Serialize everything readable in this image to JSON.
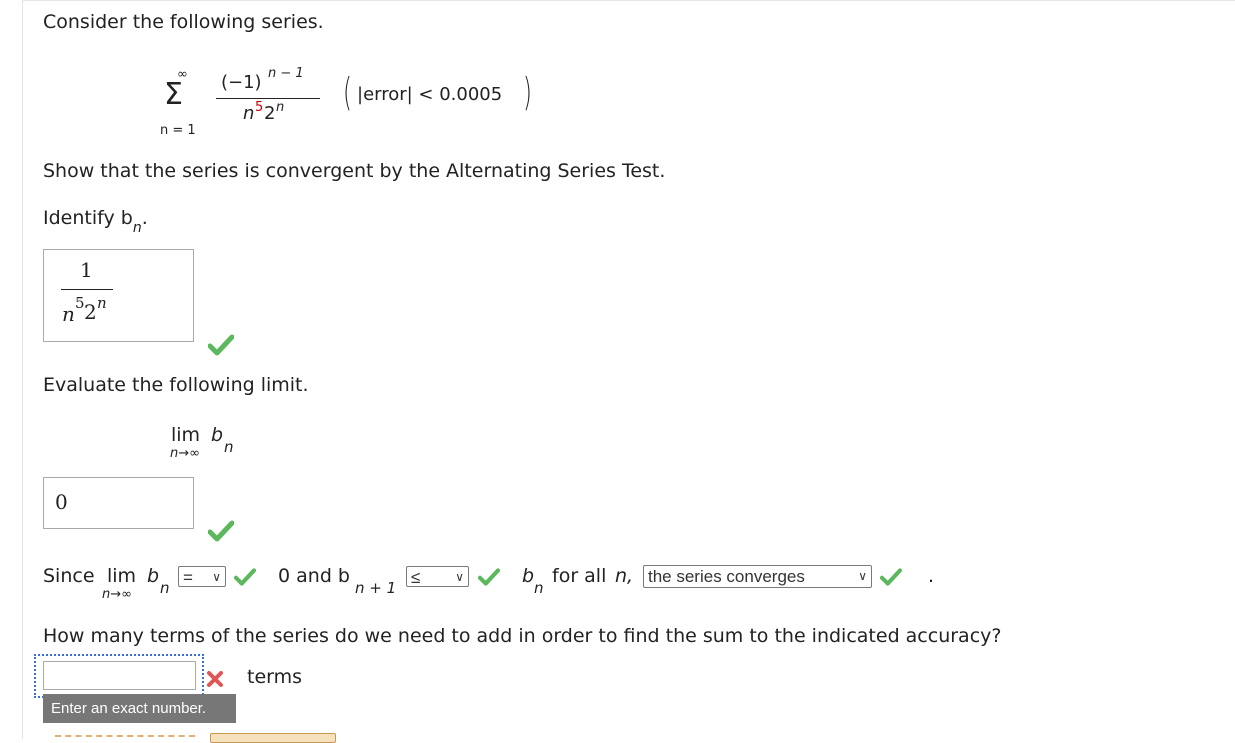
{
  "problem": {
    "intro": "Consider the following series.",
    "series": {
      "sum_symbol": "Σ",
      "upper": "∞",
      "lower": "n = 1",
      "num_base": "(−1)",
      "num_exp": "n − 1",
      "den_n": "n",
      "den_5": "5",
      "den_2": "2",
      "den_exp": "n",
      "error_text": "|error| < 0.0005"
    },
    "show_text": "Show that the series is convergent by the Alternating Series Test.",
    "identify_text": "Identify b",
    "identify_sub": "n",
    "identify_end": ".",
    "answer_bn": {
      "num": "1",
      "den_n": "n",
      "den_5": "5",
      "den_2": "2",
      "den_exp": "n"
    },
    "evaluate_text": "Evaluate the following limit.",
    "limit": {
      "lim": "lim",
      "b": "b",
      "sub": "n",
      "under": "n→∞"
    },
    "limit_answer": "0",
    "since": {
      "since_text": "Since",
      "lim": "lim",
      "b": "b",
      "sub": "n",
      "under": "n→∞",
      "select1": "=",
      "and_text": "0 and b",
      "and_sub": "n + 1",
      "select2": "≤",
      "bn_text": "b",
      "bn_sub": "n",
      "for_all": "for all",
      "n_ital": "n,",
      "select3": "the series converges",
      "period": "."
    },
    "terms_question": "How many terms of the series do we need to add in order to find the sum to the indicated accuracy?",
    "terms_input_value": "",
    "terms_label": "terms",
    "tooltip": "Enter an exact number."
  },
  "colors": {
    "correct": "#5cb85c",
    "incorrect": "#e05555",
    "exponent_red": "#cc0000"
  }
}
